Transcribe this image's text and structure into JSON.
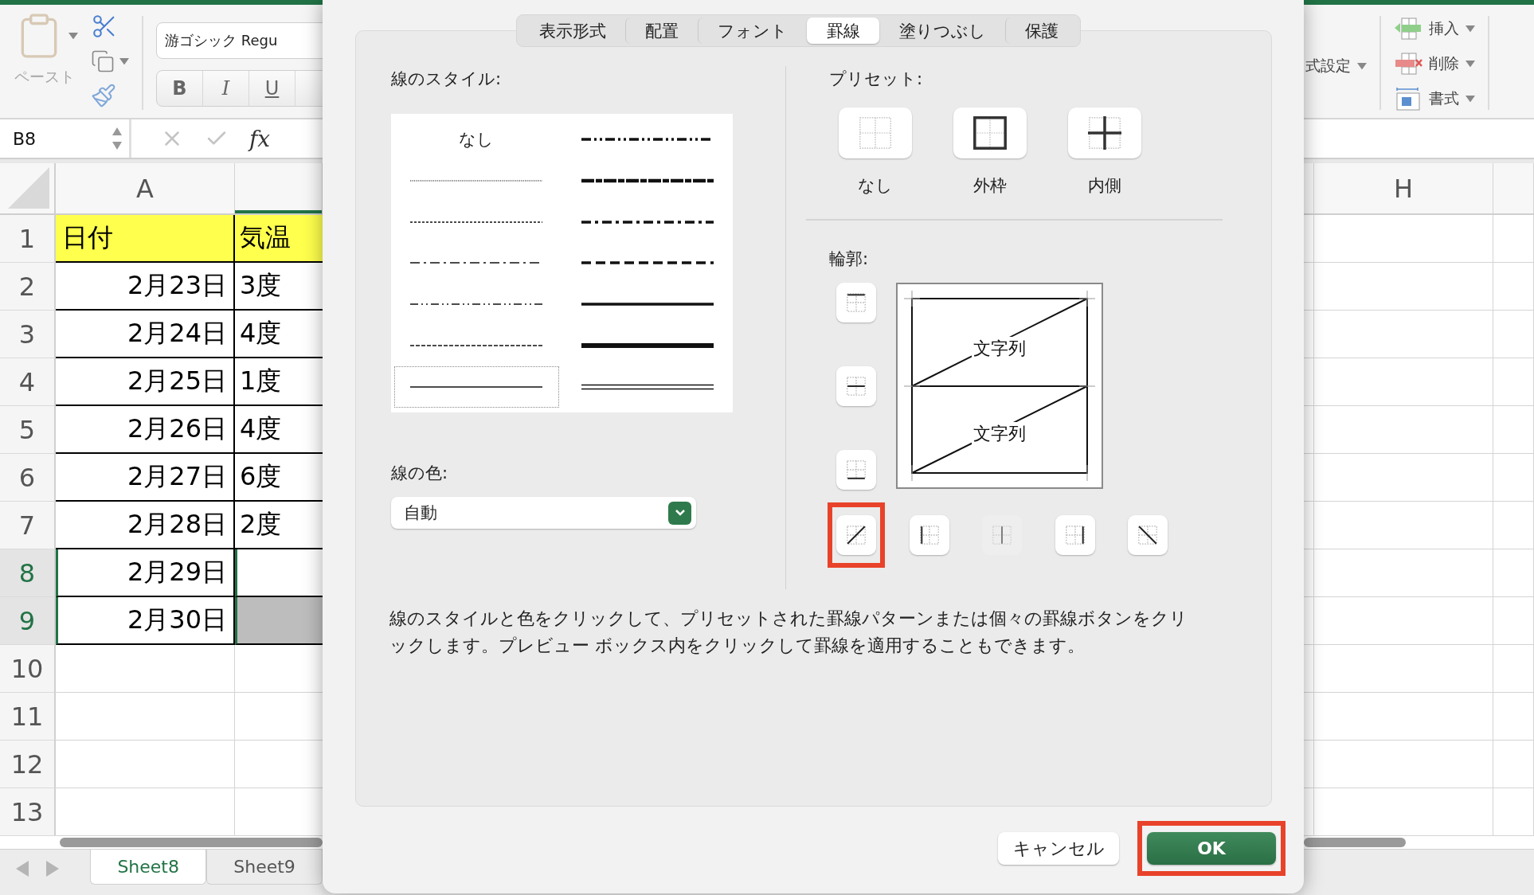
{
  "ribbon": {
    "paste_label": "ペースト",
    "font_name": "游ゴシック Regu",
    "format_buttons": [
      {
        "label": "B",
        "kind": "bold"
      },
      {
        "label": "I",
        "kind": "italic"
      },
      {
        "label": "U",
        "kind": "underline"
      }
    ],
    "right_label": "式設定",
    "cell_actions": [
      {
        "label": "挿入",
        "kind": "insert"
      },
      {
        "label": "削除",
        "kind": "delete"
      },
      {
        "label": "書式",
        "kind": "format"
      }
    ]
  },
  "formula_bar": {
    "name_box": "B8",
    "function_label": "fx"
  },
  "sheet": {
    "left_column": "A",
    "right_column": "H",
    "rows": [
      {
        "number": "1",
        "date": "日付",
        "temp": "気温",
        "kind": "header",
        "selected": false,
        "active": false
      },
      {
        "number": "2",
        "date": "2月23日",
        "temp": "3度",
        "kind": "data",
        "selected": false,
        "active": false
      },
      {
        "number": "3",
        "date": "2月24日",
        "temp": "4度",
        "kind": "data",
        "selected": false,
        "active": false
      },
      {
        "number": "4",
        "date": "2月25日",
        "temp": "1度",
        "kind": "data",
        "selected": false,
        "active": false
      },
      {
        "number": "5",
        "date": "2月26日",
        "temp": "4度",
        "kind": "data",
        "selected": false,
        "active": false
      },
      {
        "number": "6",
        "date": "2月27日",
        "temp": "6度",
        "kind": "data",
        "selected": false,
        "active": false
      },
      {
        "number": "7",
        "date": "2月28日",
        "temp": "2度",
        "kind": "data",
        "selected": false,
        "active": false
      },
      {
        "number": "8",
        "date": "2月29日",
        "kind": "data",
        "selected": true,
        "active": true
      },
      {
        "number": "9",
        "date": "2月30日",
        "kind": "data",
        "selected": true,
        "active": false
      },
      {
        "number": "10",
        "kind": "empty",
        "selected": false,
        "active": false
      },
      {
        "number": "11",
        "kind": "empty",
        "selected": false,
        "active": false
      },
      {
        "number": "12",
        "kind": "empty",
        "selected": false,
        "active": false
      },
      {
        "number": "13",
        "kind": "empty",
        "selected": false,
        "active": false
      }
    ],
    "tabs": [
      {
        "label": "Sheet8",
        "selected": true
      },
      {
        "label": "Sheet9",
        "selected": false
      }
    ]
  },
  "dialog": {
    "tabs": [
      {
        "label": "表示形式",
        "selected": false
      },
      {
        "label": "配置",
        "selected": false
      },
      {
        "label": "フォント",
        "selected": false
      },
      {
        "label": "罫線",
        "selected": true
      },
      {
        "label": "塗りつぶし",
        "selected": false
      },
      {
        "label": "保護",
        "selected": false
      }
    ],
    "line_style": {
      "label": "線のスタイル:",
      "styles": [
        {
          "kind": "none",
          "label": "なし",
          "selected": false
        },
        {
          "kind": "hair",
          "selected": false
        },
        {
          "kind": "dotted",
          "selected": false
        },
        {
          "kind": "dash-dot",
          "selected": false
        },
        {
          "kind": "dash-dot-dot",
          "selected": false
        },
        {
          "kind": "dashed",
          "selected": false
        },
        {
          "kind": "thin",
          "selected": true
        },
        {
          "kind": "medium-dash-dot-dot",
          "selected": false
        },
        {
          "kind": "slanted-dash-dot",
          "selected": false
        },
        {
          "kind": "medium-dash-dot",
          "selected": false
        },
        {
          "kind": "medium-dashed",
          "selected": false
        },
        {
          "kind": "medium",
          "selected": false
        },
        {
          "kind": "thick",
          "selected": false
        },
        {
          "kind": "double",
          "selected": false
        }
      ]
    },
    "line_color": {
      "label": "線の色:",
      "value": "自動"
    },
    "presets": {
      "label": "プリセット:",
      "items": [
        {
          "label": "なし",
          "kind": "none"
        },
        {
          "label": "外枠",
          "kind": "outline"
        },
        {
          "label": "内側",
          "kind": "inside"
        }
      ]
    },
    "border": {
      "label": "輪郭:",
      "side_buttons": [
        {
          "kind": "top",
          "disabled": false
        },
        {
          "kind": "middle",
          "disabled": false
        },
        {
          "kind": "bottom",
          "disabled": false
        }
      ],
      "bottom_buttons": [
        {
          "kind": "diag-up",
          "disabled": false,
          "highlighted": true
        },
        {
          "kind": "left",
          "disabled": false,
          "highlighted": false
        },
        {
          "kind": "center",
          "disabled": true,
          "highlighted": false
        },
        {
          "kind": "right",
          "disabled": false,
          "highlighted": false
        },
        {
          "kind": "diag-down",
          "disabled": false,
          "highlighted": false
        }
      ],
      "preview_texts": [
        "文字列",
        "文字列"
      ]
    },
    "description": "線のスタイルと色をクリックして、プリセットされた罫線パターンまたは個々の罫線ボタンをクリックします。プレビュー ボックス内をクリックして罫線を適用することもできます。",
    "buttons": [
      {
        "label": "キャンセル",
        "kind": "cancel",
        "highlighted": false
      },
      {
        "label": "OK",
        "kind": "ok",
        "highlighted": true
      }
    ]
  }
}
